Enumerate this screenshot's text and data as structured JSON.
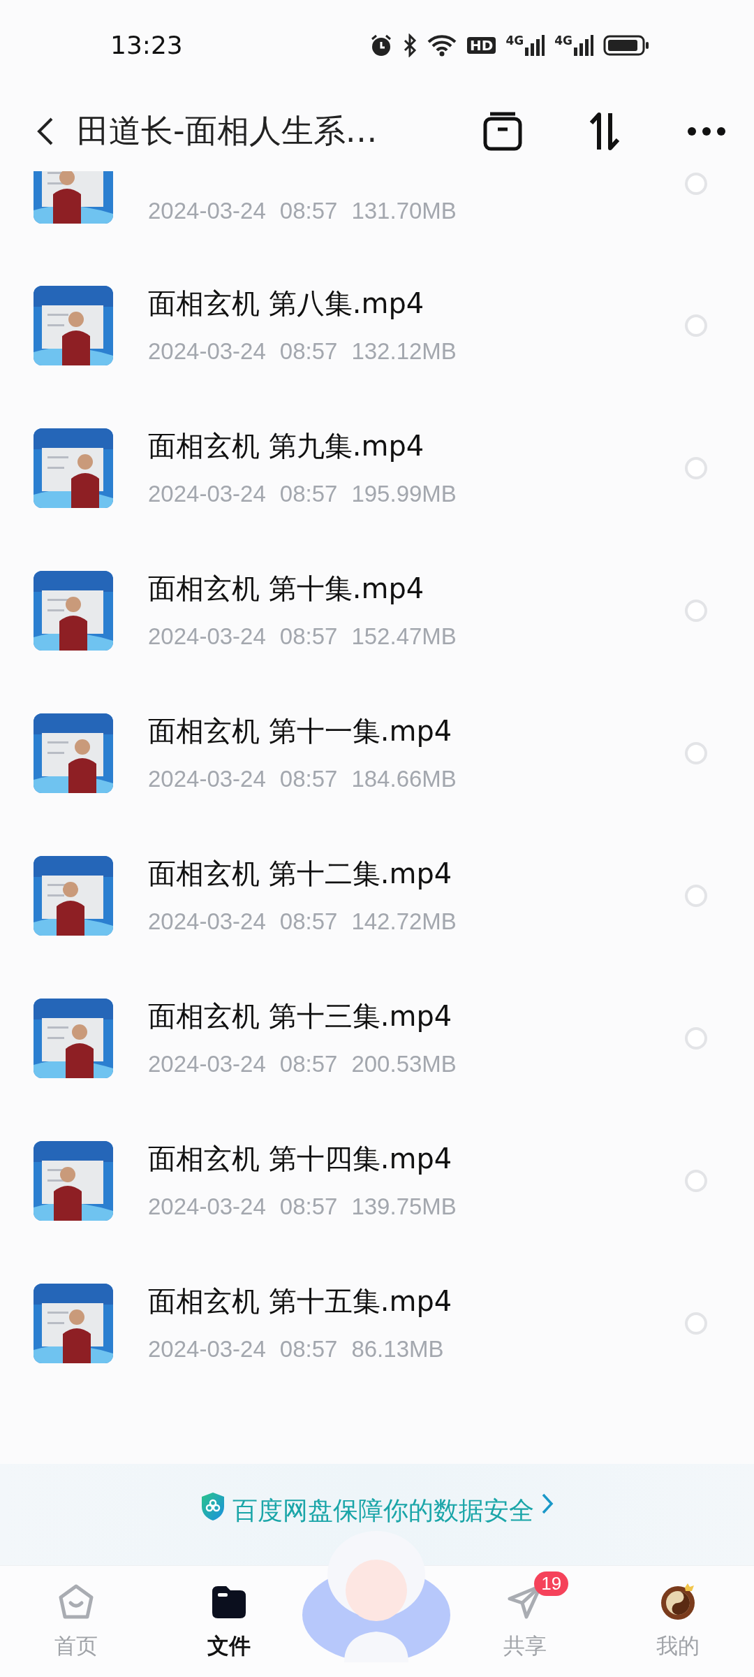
{
  "status_bar": {
    "time": "13:23",
    "hd": "HD",
    "network_1": "4G",
    "network_2": "4G"
  },
  "header": {
    "title": "田道长-面相人生系…"
  },
  "files": [
    {
      "kind": "cut",
      "date": "2024-03-24",
      "time": "08:57",
      "size": "131.70MB",
      "selected": false
    },
    {
      "kind": "file",
      "name": "面相玄机 第八集.mp4",
      "date": "2024-03-24",
      "time": "08:57",
      "size": "132.12MB",
      "selected": false
    },
    {
      "kind": "file",
      "name": "面相玄机 第九集.mp4",
      "date": "2024-03-24",
      "time": "08:57",
      "size": "195.99MB",
      "selected": false
    },
    {
      "kind": "file",
      "name": "面相玄机 第十集.mp4",
      "date": "2024-03-24",
      "time": "08:57",
      "size": "152.47MB",
      "selected": false
    },
    {
      "kind": "file",
      "name": "面相玄机 第十一集.mp4",
      "date": "2024-03-24",
      "time": "08:57",
      "size": "184.66MB",
      "selected": false
    },
    {
      "kind": "file",
      "name": "面相玄机 第十二集.mp4",
      "date": "2024-03-24",
      "time": "08:57",
      "size": "142.72MB",
      "selected": false
    },
    {
      "kind": "file",
      "name": "面相玄机 第十三集.mp4",
      "date": "2024-03-24",
      "time": "08:57",
      "size": "200.53MB",
      "selected": false
    },
    {
      "kind": "file",
      "name": "面相玄机 第十四集.mp4",
      "date": "2024-03-24",
      "time": "08:57",
      "size": "139.75MB",
      "selected": false
    },
    {
      "kind": "file",
      "name": "面相玄机 第十五集.mp4",
      "date": "2024-03-24",
      "time": "08:57",
      "size": "86.13MB",
      "selected": false
    }
  ],
  "banner": {
    "text": "百度网盘保障你的数据安全"
  },
  "nav": [
    {
      "kind": "home",
      "label": "首页",
      "selected": false
    },
    {
      "kind": "files",
      "label": "文件",
      "selected": true
    },
    {
      "kind": "assistant",
      "selected": false
    },
    {
      "kind": "share",
      "label": "共享",
      "selected": false,
      "badge": "19"
    },
    {
      "kind": "me",
      "label": "我的",
      "selected": false
    }
  ]
}
